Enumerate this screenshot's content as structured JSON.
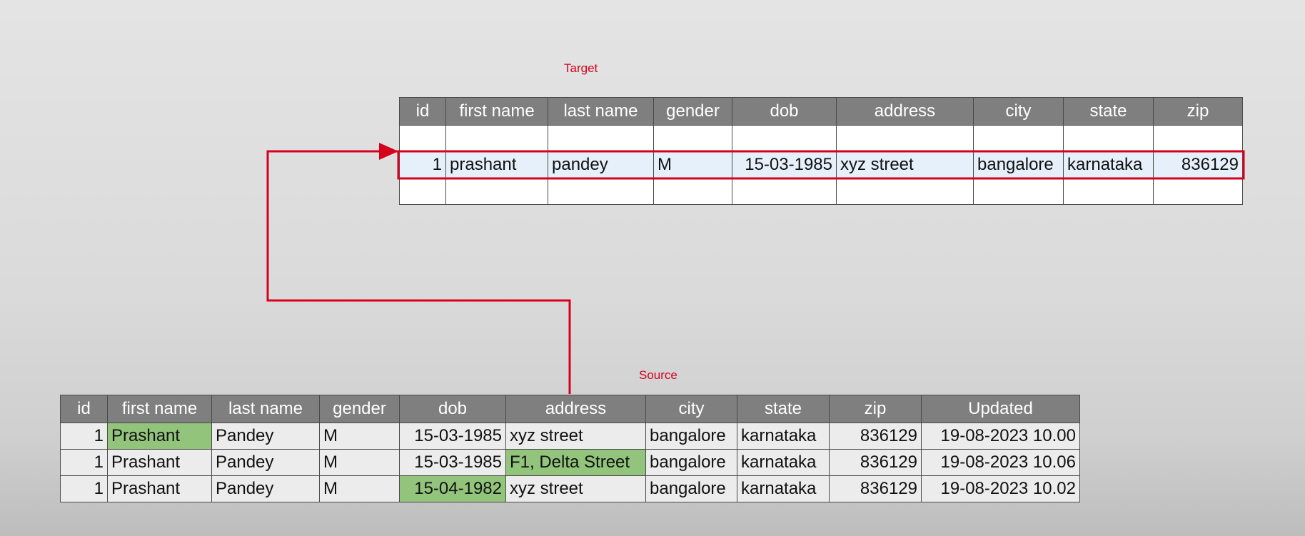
{
  "target": {
    "caption": "Target",
    "columns": [
      "id",
      "first name",
      "last name",
      "gender",
      "dob",
      "address",
      "city",
      "state",
      "zip"
    ],
    "row": {
      "id": "1",
      "first_name": "prashant",
      "last_name": "pandey",
      "gender": "M",
      "dob": "15-03-1985",
      "address": "xyz street",
      "city": "bangalore",
      "state": "karnataka",
      "zip": "836129"
    }
  },
  "source": {
    "caption": "Source",
    "columns": [
      "id",
      "first name",
      "last name",
      "gender",
      "dob",
      "address",
      "city",
      "state",
      "zip",
      "Updated"
    ],
    "rows": [
      {
        "id": "1",
        "first_name": "Prashant",
        "last_name": "Pandey",
        "gender": "M",
        "dob": "15-03-1985",
        "address": "xyz street",
        "city": "bangalore",
        "state": "karnataka",
        "zip": "836129",
        "updated": "19-08-2023 10.00"
      },
      {
        "id": "1",
        "first_name": "Prashant",
        "last_name": "Pandey",
        "gender": "M",
        "dob": "15-03-1985",
        "address": "F1, Delta Street",
        "city": "bangalore",
        "state": "karnataka",
        "zip": "836129",
        "updated": "19-08-2023 10.06"
      },
      {
        "id": "1",
        "first_name": "Prashant",
        "last_name": "Pandey",
        "gender": "M",
        "dob": "15-04-1982",
        "address": "xyz street",
        "city": "bangalore",
        "state": "karnataka",
        "zip": "836129",
        "updated": "19-08-2023 10.02"
      }
    ]
  },
  "colors": {
    "caption": "#d6001c",
    "header_bg": "#7f7f7f",
    "highlight_row": "#e6f0fb",
    "changed_cell": "#92c47c",
    "arrow": "#d6001c"
  }
}
